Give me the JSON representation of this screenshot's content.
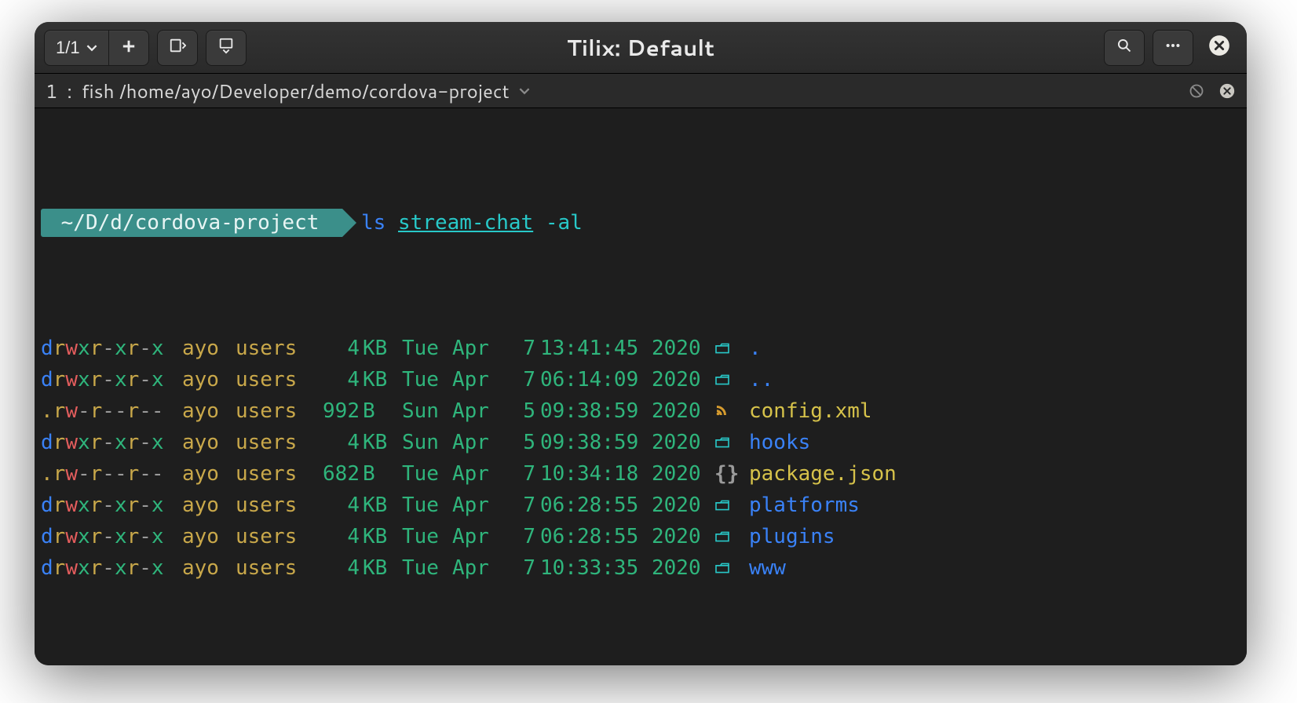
{
  "window": {
    "title": "Tilix: Default",
    "session_counter": "1/1"
  },
  "tab": {
    "index": "1",
    "label": "fish /home/ayo/Developer/demo/cordova-project"
  },
  "prompt": {
    "path": " ~/D/d/cordova-project "
  },
  "command": {
    "cmd": "ls",
    "arg": "stream-chat",
    "flag": "-al"
  },
  "listing": [
    {
      "perm": "drwxr-xr-x",
      "owner": "ayo",
      "group": "users",
      "size": "4",
      "unit": "KB",
      "dow": "Tue",
      "mon": "Apr",
      "day": "7",
      "time": "13:41:45",
      "year": "2020",
      "icon": "folder",
      "name": ".",
      "kind": "dir"
    },
    {
      "perm": "drwxr-xr-x",
      "owner": "ayo",
      "group": "users",
      "size": "4",
      "unit": "KB",
      "dow": "Tue",
      "mon": "Apr",
      "day": "7",
      "time": "06:14:09",
      "year": "2020",
      "icon": "folder",
      "name": "..",
      "kind": "dir"
    },
    {
      "perm": ".rw-r--r--",
      "owner": "ayo",
      "group": "users",
      "size": "992",
      "unit": "B",
      "dow": "Sun",
      "mon": "Apr",
      "day": "5",
      "time": "09:38:59",
      "year": "2020",
      "icon": "rss",
      "name": "config.xml",
      "kind": "file"
    },
    {
      "perm": "drwxr-xr-x",
      "owner": "ayo",
      "group": "users",
      "size": "4",
      "unit": "KB",
      "dow": "Sun",
      "mon": "Apr",
      "day": "5",
      "time": "09:38:59",
      "year": "2020",
      "icon": "folder",
      "name": "hooks",
      "kind": "dir"
    },
    {
      "perm": ".rw-r--r--",
      "owner": "ayo",
      "group": "users",
      "size": "682",
      "unit": "B",
      "dow": "Tue",
      "mon": "Apr",
      "day": "7",
      "time": "10:34:18",
      "year": "2020",
      "icon": "json",
      "name": "package.json",
      "kind": "file"
    },
    {
      "perm": "drwxr-xr-x",
      "owner": "ayo",
      "group": "users",
      "size": "4",
      "unit": "KB",
      "dow": "Tue",
      "mon": "Apr",
      "day": "7",
      "time": "06:28:55",
      "year": "2020",
      "icon": "folder",
      "name": "platforms",
      "kind": "dir"
    },
    {
      "perm": "drwxr-xr-x",
      "owner": "ayo",
      "group": "users",
      "size": "4",
      "unit": "KB",
      "dow": "Tue",
      "mon": "Apr",
      "day": "7",
      "time": "06:28:55",
      "year": "2020",
      "icon": "folder",
      "name": "plugins",
      "kind": "dir"
    },
    {
      "perm": "drwxr-xr-x",
      "owner": "ayo",
      "group": "users",
      "size": "4",
      "unit": "KB",
      "dow": "Tue",
      "mon": "Apr",
      "day": "7",
      "time": "10:33:35",
      "year": "2020",
      "icon": "folder",
      "name": "www",
      "kind": "dir"
    }
  ],
  "icons": {
    "folder": "📂",
    "rss": "▶",
    "json": "{}"
  }
}
